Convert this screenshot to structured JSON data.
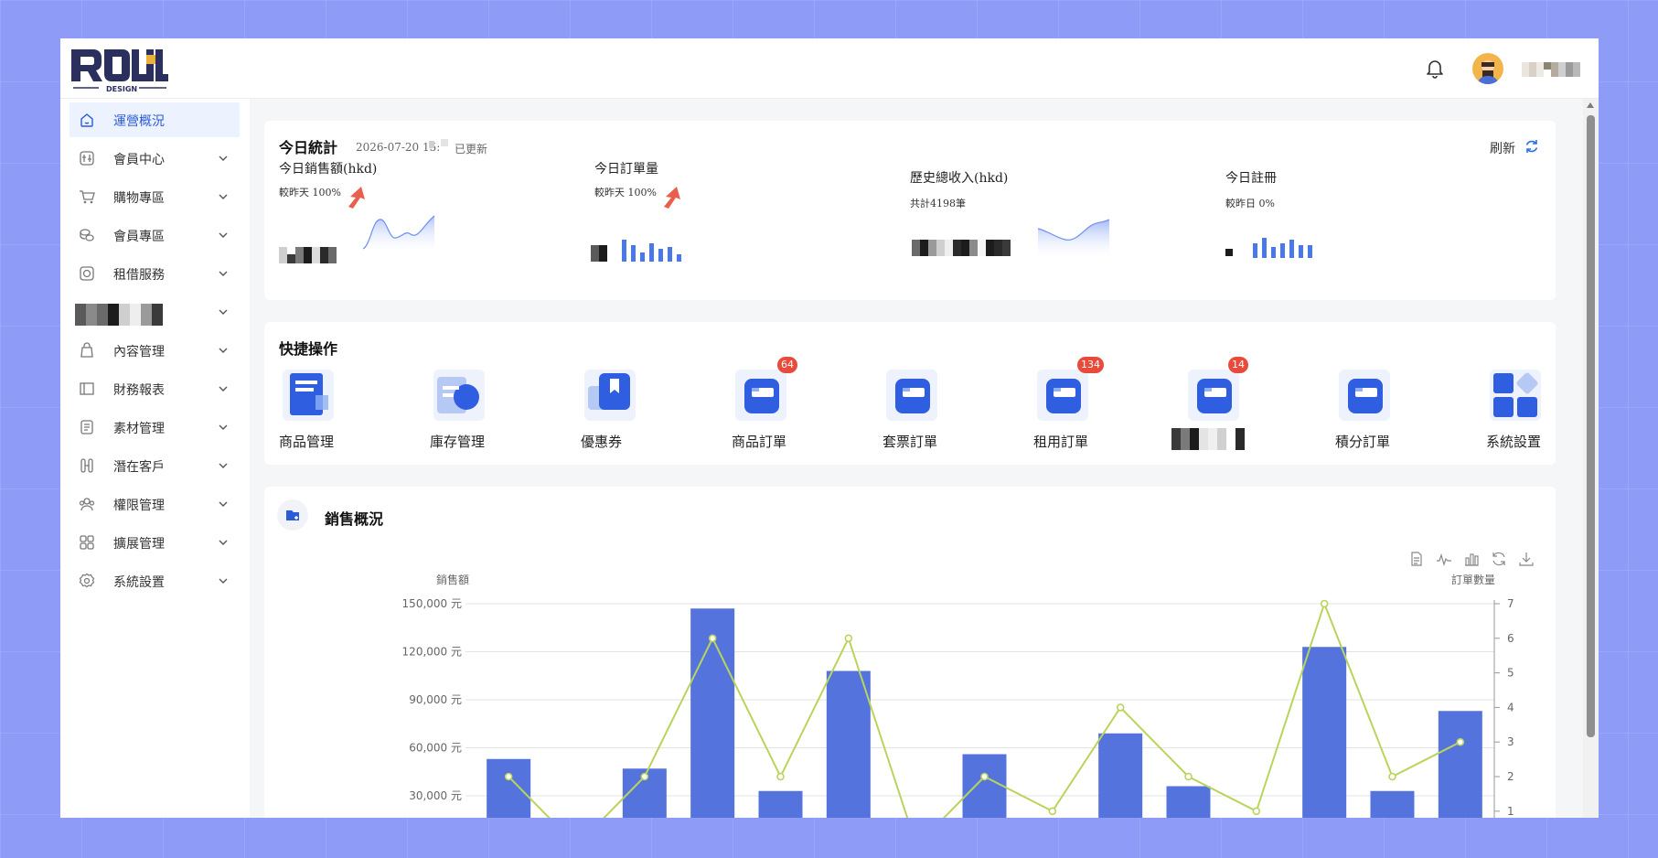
{
  "header": {
    "logo_text": "ROLL",
    "logo_sub": "DESIGN",
    "user_icon": "bell-icon"
  },
  "sidebar": {
    "items": [
      {
        "label": "運營概況",
        "icon": "home-icon",
        "active": true
      },
      {
        "label": "會員中心",
        "icon": "member-icon"
      },
      {
        "label": "購物專區",
        "icon": "cart-icon"
      },
      {
        "label": "會員專區",
        "icon": "coins-icon"
      },
      {
        "label": "租借服務",
        "icon": "rental-icon"
      },
      {
        "label": "",
        "icon": "redacted"
      },
      {
        "label": "內容管理",
        "icon": "content-icon"
      },
      {
        "label": "財務報表",
        "icon": "report-icon"
      },
      {
        "label": "素材管理",
        "icon": "material-icon"
      },
      {
        "label": "潛在客戶",
        "icon": "leads-icon"
      },
      {
        "label": "權限管理",
        "icon": "permission-icon"
      },
      {
        "label": "擴展管理",
        "icon": "extension-icon"
      },
      {
        "label": "系統設置",
        "icon": "settings-icon"
      }
    ]
  },
  "stats": {
    "title": "今日統計",
    "date": "2026-07-20 15:",
    "updated": "已更新",
    "refresh": "刷新",
    "blocks": [
      {
        "name": "今日銷售額(hkd)",
        "sub": "較昨天 100%"
      },
      {
        "name": "今日訂單量",
        "sub": "較昨天 100%"
      },
      {
        "name": "歷史總收入(hkd)",
        "sub": "共計4198筆"
      },
      {
        "name": "今日註冊",
        "sub": "較昨日 0%"
      }
    ]
  },
  "ops": {
    "title": "快捷操作",
    "items": [
      {
        "label": "商品管理",
        "badge": ""
      },
      {
        "label": "庫存管理",
        "badge": ""
      },
      {
        "label": "優惠券",
        "badge": ""
      },
      {
        "label": "商品訂單",
        "badge": "64"
      },
      {
        "label": "套票訂單",
        "badge": ""
      },
      {
        "label": "租用訂單",
        "badge": "134"
      },
      {
        "label": "",
        "badge": "14"
      },
      {
        "label": "積分訂單",
        "badge": ""
      },
      {
        "label": "系統設置",
        "badge": ""
      }
    ]
  },
  "sales": {
    "title": "銷售概況"
  },
  "chart_data": {
    "type": "bar",
    "ylabel": "銷售額",
    "y2label": "訂單數量",
    "ylim": [
      0,
      150000
    ],
    "y2lim": [
      0,
      7
    ],
    "yticks": [
      "30,000 元",
      "60,000 元",
      "90,000 元",
      "120,000 元",
      "150,000 元"
    ],
    "y2ticks": [
      "1",
      "2",
      "3",
      "4",
      "5",
      "6",
      "7"
    ],
    "series": [
      {
        "type": "bar",
        "values": [
          53000,
          0,
          47000,
          147000,
          33000,
          108000,
          0,
          56000,
          0,
          69000,
          36000,
          0,
          123000,
          33000,
          83000
        ]
      },
      {
        "type": "line",
        "values": [
          2,
          0,
          2,
          6,
          2,
          6,
          0,
          2,
          1,
          4,
          2,
          1,
          7,
          2,
          3
        ]
      }
    ],
    "colors": {
      "bar": "#5473dd",
      "line": "#b9d45c"
    }
  }
}
